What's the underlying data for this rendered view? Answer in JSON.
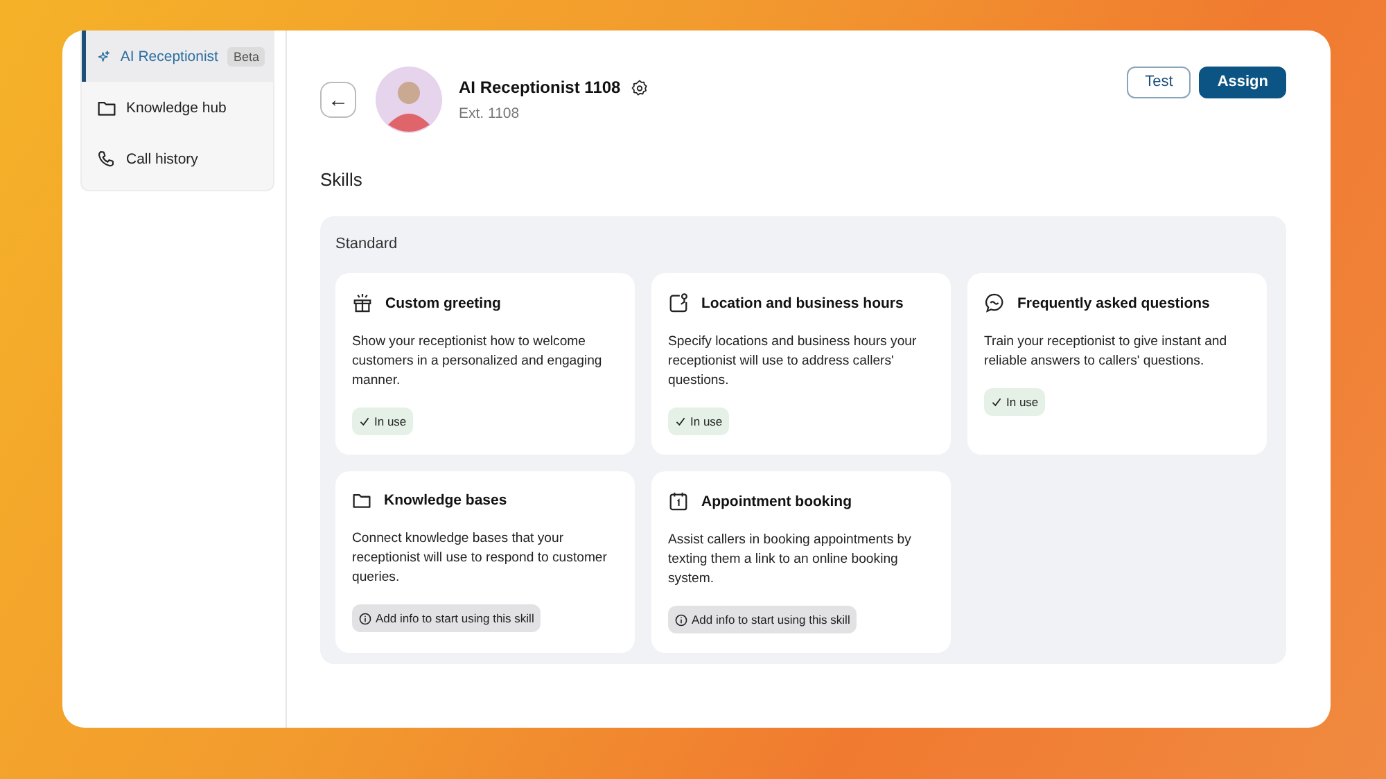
{
  "sidebar": {
    "items": [
      {
        "label": "AI Receptionist",
        "kind": "sparkle",
        "selected": true,
        "badge": "Beta"
      },
      {
        "label": "Knowledge hub",
        "kind": "folder",
        "selected": false
      },
      {
        "label": "Call history",
        "kind": "phone",
        "selected": false
      }
    ]
  },
  "header": {
    "back": "←",
    "name": "AI Receptionist 1108",
    "extension": "Ext. 1108",
    "buttons": [
      {
        "label": "Test",
        "kind": "outline"
      },
      {
        "label": "Assign",
        "kind": "primary"
      }
    ]
  },
  "section_title": "Skills",
  "group": {
    "title": "Standard",
    "skills": [
      {
        "kind": "gift",
        "title": "Custom greeting",
        "description": "Show your receptionist how to welcome customers in a personalized and engaging manner.",
        "in_use": true,
        "status_label": "In use"
      },
      {
        "kind": "location",
        "title": "Location and business hours",
        "description": "Specify locations and business hours your receptionist will use to address callers' questions.",
        "in_use": true,
        "status_label": "In use"
      },
      {
        "kind": "chat",
        "title": "Frequently asked questions",
        "description": "Train your receptionist to give instant and reliable answers to callers' questions.",
        "in_use": true,
        "status_label": "In use"
      },
      {
        "kind": "folder",
        "title": "Knowledge bases",
        "description": "Connect knowledge bases that your receptionist will use to respond to customer queries.",
        "in_use": false,
        "status_label": "Add info to start using this skill"
      },
      {
        "kind": "calendar",
        "title": "Appointment booking",
        "description": "Assist callers in booking appointments by texting them a link to an online booking system.",
        "in_use": false,
        "status_label": "Add info to start using this skill"
      }
    ]
  }
}
